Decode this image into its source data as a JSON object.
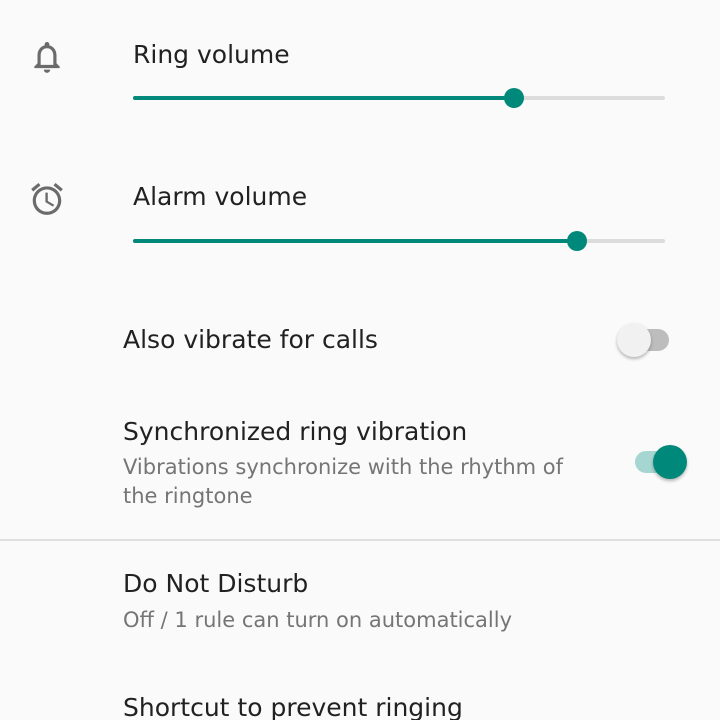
{
  "ring_volume": {
    "label": "Ring volume",
    "icon": "bell-icon",
    "level": 0.716
  },
  "alarm_volume": {
    "label": "Alarm volume",
    "icon": "alarm-clock-icon",
    "level": 0.835
  },
  "vibrate_for_calls": {
    "label": "Also vibrate for calls",
    "enabled": false
  },
  "synchronized_vibration": {
    "label": "Synchronized ring vibration",
    "summary": "Vibrations synchronize with the rhythm of the ringtone",
    "enabled": true
  },
  "do_not_disturb": {
    "label": "Do Not Disturb",
    "summary": "Off / 1 rule can turn on automatically"
  },
  "prevent_ringing": {
    "label": "Shortcut to prevent ringing"
  },
  "colors": {
    "accent": "#00897b",
    "track_inactive": "#dcdcdc",
    "switch_on_track": "#a6d6d1",
    "switch_off_track": "#bdbdbd"
  }
}
